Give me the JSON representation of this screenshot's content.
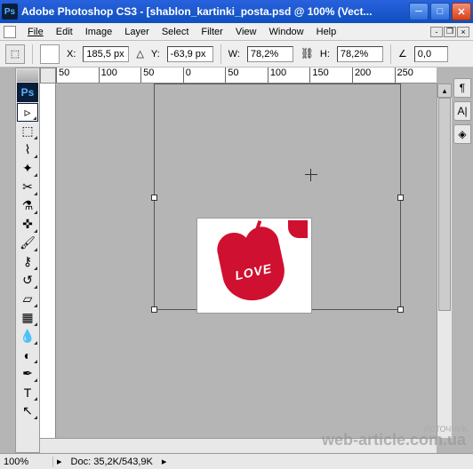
{
  "window": {
    "title": "Adobe Photoshop CS3 - [shablon_kartinki_posta.psd @ 100% (Vect...",
    "app_short": "Ps"
  },
  "menu": {
    "file": "File",
    "edit": "Edit",
    "image": "Image",
    "layer": "Layer",
    "select": "Select",
    "filter": "Filter",
    "view": "View",
    "window": "Window",
    "help": "Help"
  },
  "options": {
    "x_label": "X:",
    "x_value": "185,5 px",
    "y_label": "Y:",
    "y_value": "-63,9 px",
    "w_label": "W:",
    "w_value": "78,2%",
    "h_label": "H:",
    "h_value": "78,2%",
    "angle_label": "∠",
    "angle_value": "0,0"
  },
  "ruler": {
    "m50": "50",
    "m100": "100",
    "m150": "150",
    "m200": "200",
    "m250": "250",
    "m0": "0",
    "m50b": "50"
  },
  "image_content": {
    "text": "LOVE"
  },
  "status": {
    "zoom": "100%",
    "doc_label": "Doc:",
    "doc_value": "35,2K/543,9K"
  },
  "watermark": "web-article.com.ua",
  "watermark_label": "ИСТОЧНИК:"
}
